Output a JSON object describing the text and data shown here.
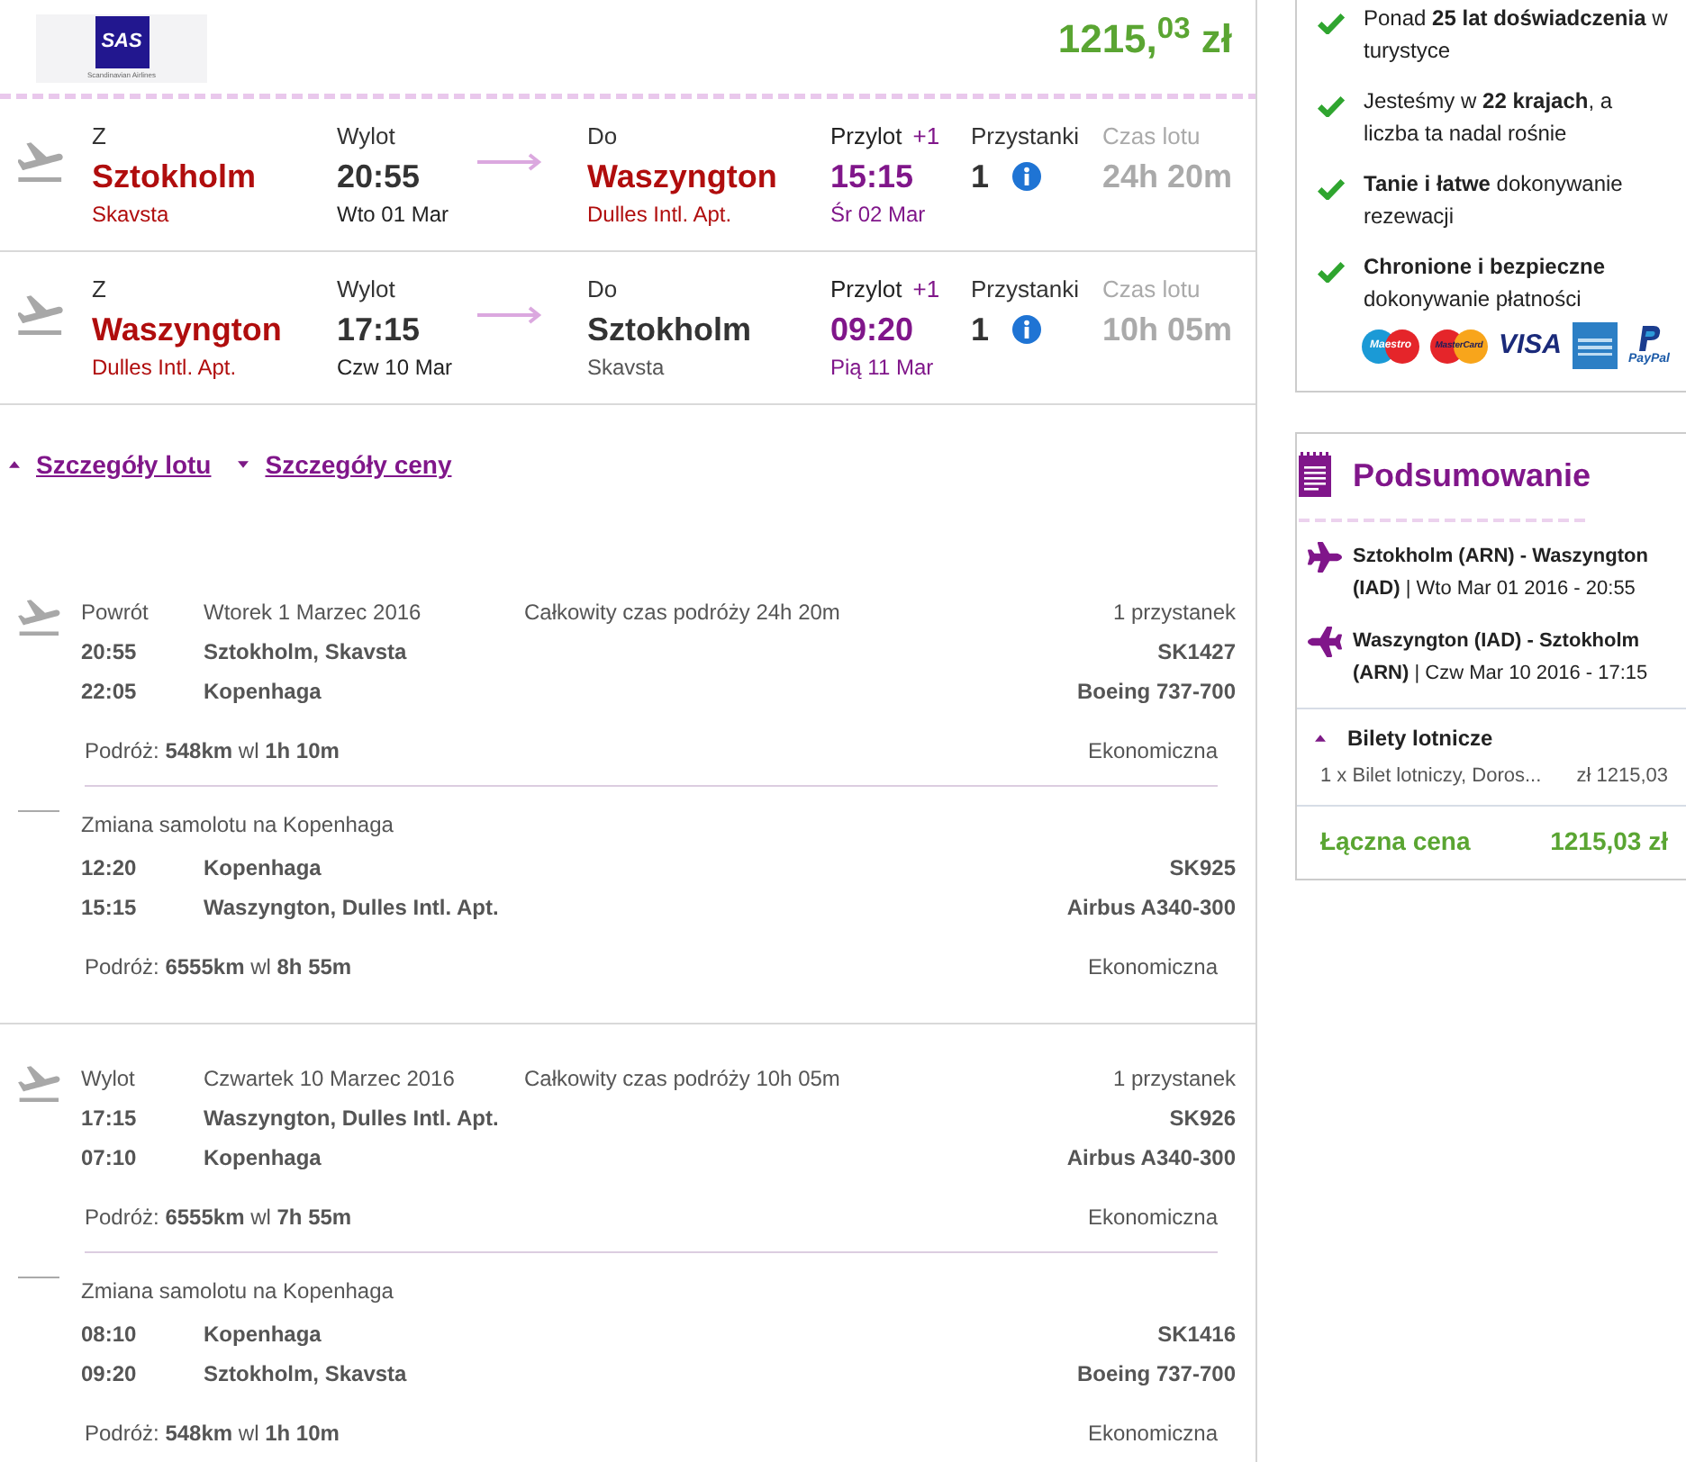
{
  "header": {
    "logo": {
      "mark": "SAS",
      "caption": "Scandinavian Airlines"
    },
    "price": "1215,$^{03}$ zł"
  },
  "flights": [
    {
      "from": {
        "label": "Z",
        "city": "Sztokholm",
        "airport": "Skavsta",
        "highlighted": true
      },
      "departure": {
        "label": "Wylot",
        "time": "20:55",
        "date": "Wto 01 Mar"
      },
      "to": {
        "label": "Do",
        "city": "Waszyngton",
        "airport": "Dulles Intl. Apt.",
        "highlighted": true
      },
      "arrival": {
        "label": "Przylot",
        "day_offset": "+1",
        "time": "15:15",
        "date": "Śr 02 Mar"
      },
      "stops": {
        "label": "Przystanki",
        "count": "1"
      },
      "duration": {
        "label": "Czas lotu",
        "value": "24h 20m"
      }
    },
    {
      "from": {
        "label": "Z",
        "city": "Waszyngton",
        "airport": "Dulles Intl. Apt.",
        "highlighted": true
      },
      "departure": {
        "label": "Wylot",
        "time": "17:15",
        "date": "Czw 10 Mar"
      },
      "to": {
        "label": "Do",
        "city": "Sztokholm",
        "airport": "Skavsta",
        "highlighted": false
      },
      "arrival": {
        "label": "Przylot",
        "day_offset": "+1",
        "time": "09:20",
        "date": "Pią 11 Mar"
      },
      "stops": {
        "label": "Przystanki",
        "count": "1"
      },
      "duration": {
        "label": "Czas lotu",
        "value": "10h 05m"
      }
    }
  ],
  "detail_links": [
    {
      "label": "Szczegóły lotu",
      "expanded": true
    },
    {
      "label": "Szczegóły ceny",
      "expanded": false
    }
  ],
  "legs": [
    {
      "type_label": "Powrót",
      "date": "Wtorek 1 Marzec 2016",
      "total_time": "Całkowity czas podróży 24h 20m",
      "stops": "1 przystanek",
      "segments": [
        {
          "departure": {
            "time": "20:55",
            "place": "Sztokholm, Skavsta"
          },
          "flight_number": "SK1427",
          "arrival": {
            "time": "22:05",
            "place": "Kopenhaga"
          },
          "aircraft": "Boeing 737-700",
          "trip": "Podróż: **548km** wl **1h 10m**",
          "cabin": "Ekonomiczna"
        },
        {
          "change_note": "Zmiana samolotu na Kopenhaga",
          "departure": {
            "time": "12:20",
            "place": "Kopenhaga"
          },
          "flight_number": "SK925",
          "arrival": {
            "time": "15:15",
            "place": "Waszyngton, Dulles Intl. Apt."
          },
          "aircraft": "Airbus A340-300",
          "trip": "Podróż: **6555km** wl **8h 55m**",
          "cabin": "Ekonomiczna"
        }
      ]
    },
    {
      "type_label": "Wylot",
      "date": "Czwartek 10 Marzec 2016",
      "total_time": "Całkowity czas podróży 10h 05m",
      "stops": "1 przystanek",
      "segments": [
        {
          "departure": {
            "time": "17:15",
            "place": "Waszyngton, Dulles Intl. Apt."
          },
          "flight_number": "SK926",
          "arrival": {
            "time": "07:10",
            "place": "Kopenhaga"
          },
          "aircraft": "Airbus A340-300",
          "trip": "Podróż: **6555km** wl **7h 55m**",
          "cabin": "Ekonomiczna"
        },
        {
          "change_note": "Zmiana samolotu na Kopenhaga",
          "departure": {
            "time": "08:10",
            "place": "Kopenhaga"
          },
          "flight_number": "SK1416",
          "arrival": {
            "time": "09:20",
            "place": "Sztokholm, Skavsta"
          },
          "aircraft": "Boeing 737-700",
          "trip": "Podróż: **548km** wl **1h 10m**",
          "cabin": "Ekonomiczna"
        }
      ]
    }
  ],
  "benefits": {
    "items": [
      "Ponad **25 lat doświadczenia** w turystyce",
      "Jesteśmy w **22 krajach**, a liczba ta nadal rośnie",
      "**Tanie i łatwe** dokonywanie rezewacji",
      "**Chronione i bezpieczne** dokonywanie płatności"
    ],
    "payment_methods": [
      {
        "kind": "maestro",
        "label": "Maestro"
      },
      {
        "kind": "mastercard",
        "label": "MasterCard"
      },
      {
        "kind": "visa",
        "label": "VISA"
      },
      {
        "kind": "amex"
      },
      {
        "kind": "paypal",
        "label": "PayPal"
      }
    ]
  },
  "summary": {
    "title": "Podsumowanie",
    "flights": [
      {
        "kind": "outbound",
        "text": "**Sztokholm (ARN) - Waszyngton (IAD)** | Wto Mar 01 2016 - 20:55"
      },
      {
        "kind": "return",
        "text": "**Waszyngton (IAD) - Sztokholm (ARN)** | Czw Mar 10 2016 - 17:15"
      }
    ],
    "tickets": {
      "label": "Bilety lotnicze",
      "expanded": true,
      "items": [
        {
          "description": "1 x Bilet lotniczy, Doros...",
          "price": "zł 1215,03"
        }
      ]
    },
    "total": {
      "label": "Łączna cena",
      "value": "1215,03 zł"
    }
  }
}
